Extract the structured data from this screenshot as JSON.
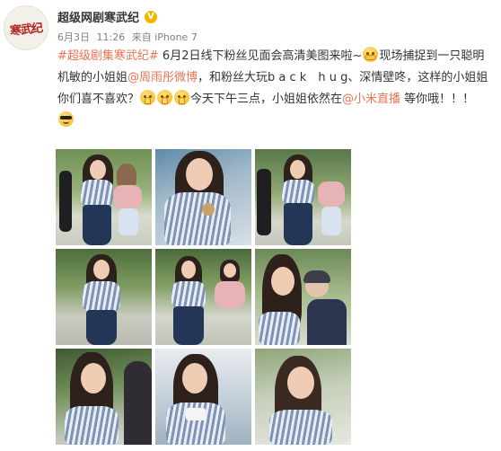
{
  "account": {
    "avatar_logo_text": "寒武纪",
    "username": "超级网剧寒武纪",
    "verified_badge_icon": "verified-v-icon",
    "verified_symbol": "V",
    "date": "6月3日",
    "time": "11:26",
    "source": "来自 iPhone 7"
  },
  "post": {
    "hashtag": "#超级剧集寒武纪#",
    "text_1": " 6月2日线下粉丝见面会高清美图来啦~",
    "text_2": "现场捕捉到一只聪明机敏的小姐姐",
    "mention_1": "@周雨彤微博",
    "text_3": "，和粉丝大玩b a c k　h u g、深情壁咚，这样的小姐姐你们喜不喜欢？",
    "text_4": "今天下午三点，小姐姐依然在",
    "mention_2": "@小米直播",
    "text_5": " 等你哦！！！"
  },
  "emojis": {
    "hug": "hug-emoji-icon",
    "pray": "pray-emoji-icon",
    "cool": "sunglasses-emoji-icon"
  },
  "colors": {
    "link": "#eb7350",
    "meta_text": "#808080",
    "body_text": "#333333",
    "verified_badge": "#f7b500"
  },
  "photos": [
    "photo-1",
    "photo-2",
    "photo-3",
    "photo-4",
    "photo-5",
    "photo-6",
    "photo-7",
    "photo-8",
    "photo-9"
  ]
}
